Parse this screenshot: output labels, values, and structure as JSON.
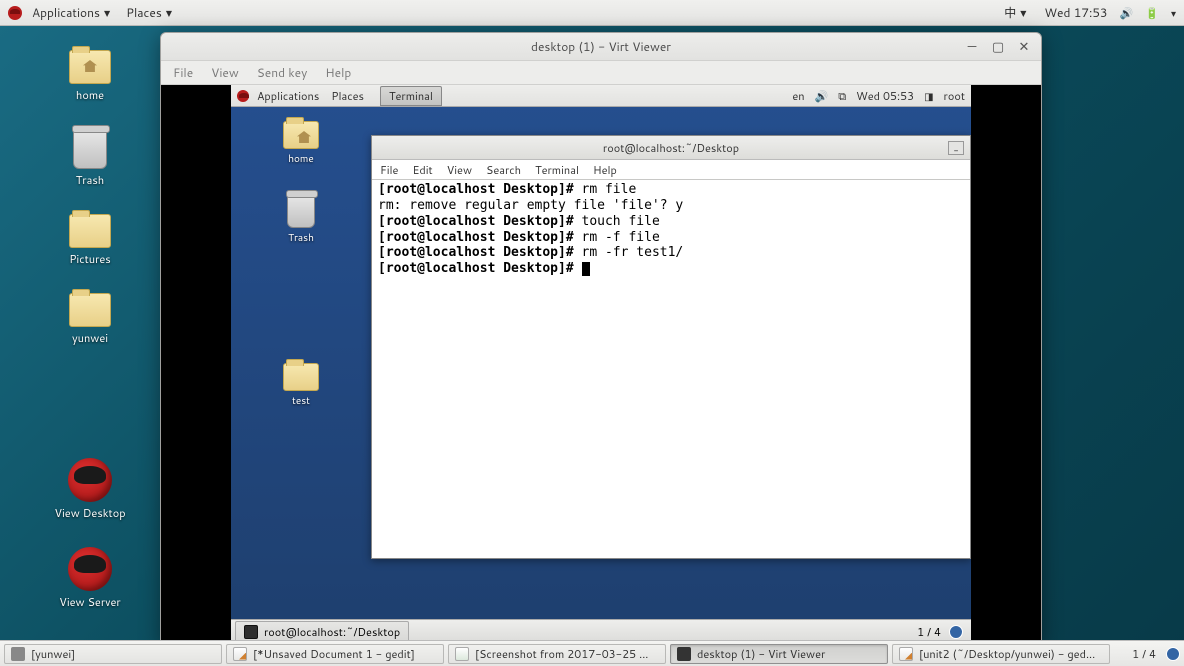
{
  "outer_panel": {
    "applications": "Applications",
    "places": "Places",
    "ime": "中",
    "datetime": "Wed 17:53"
  },
  "outer_desktop": {
    "home": "home",
    "trash": "Trash",
    "pictures": "Pictures",
    "yunwei": "yunwei",
    "view_desktop": "View Desktop",
    "view_server": "View Server"
  },
  "virt": {
    "title": "desktop (1) - Virt Viewer",
    "menu": {
      "file": "File",
      "view": "View",
      "sendkey": "Send key",
      "help": "Help"
    }
  },
  "inner_panel": {
    "applications": "Applications",
    "places": "Places",
    "terminal_tab": "Terminal",
    "lang": "en",
    "datetime": "Wed 05:53",
    "user": "root"
  },
  "inner_desktop": {
    "home": "home",
    "trash": "Trash",
    "test": "test"
  },
  "terminal": {
    "title": "root@localhost:~/Desktop",
    "menu": {
      "file": "File",
      "edit": "Edit",
      "view": "View",
      "search": "Search",
      "terminal": "Terminal",
      "help": "Help"
    },
    "lines": {
      "l1p": "[root@localhost Desktop]# ",
      "l1c": "rm file",
      "l2": "rm: remove regular empty file 'file'? y",
      "l3p": "[root@localhost Desktop]# ",
      "l3c": "touch file",
      "l4p": "[root@localhost Desktop]# ",
      "l4c": "rm -f file",
      "l5p": "[root@localhost Desktop]# ",
      "l5c": "rm -fr test1/",
      "l6p": "[root@localhost Desktop]# "
    }
  },
  "inner_taskbar": {
    "task1": "root@localhost:~/Desktop",
    "ws": "1 / 4"
  },
  "outer_taskbar": {
    "t1": "[yunwei]",
    "t2": "[*Unsaved Document 1 - gedit]",
    "t3": "[Screenshot from 2017-03-25 ...",
    "t4": "desktop (1) - Virt Viewer",
    "t5": "[unit2 (~/Desktop/yunwei) - ged...",
    "ws": "1 / 4"
  }
}
